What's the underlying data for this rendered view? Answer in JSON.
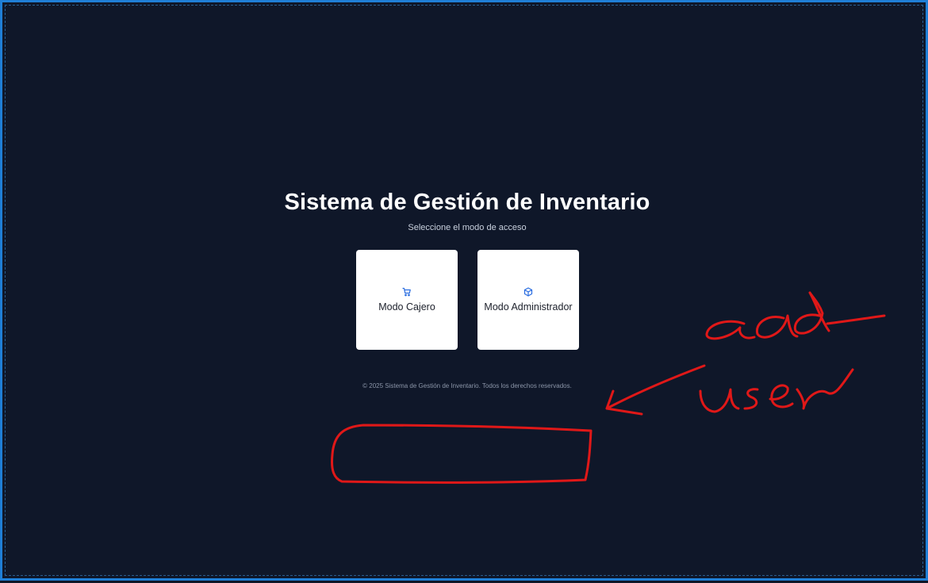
{
  "page": {
    "title": "Sistema de Gestión de Inventario",
    "subtitle": "Seleccione el modo de acceso"
  },
  "modes": [
    {
      "label": "Modo Cajero",
      "icon": "cart-icon"
    },
    {
      "label": "Modo Administrador",
      "icon": "package-icon"
    }
  ],
  "footer": {
    "text": "© 2025 Sistema de Gestión de Inventario. Todos los derechos reservados."
  },
  "annotation": {
    "handwritten_text": "add user",
    "color": "#e01818"
  },
  "colors": {
    "background": "#0f1729",
    "frame": "#1f7fd6",
    "accent": "#2a6de0"
  }
}
